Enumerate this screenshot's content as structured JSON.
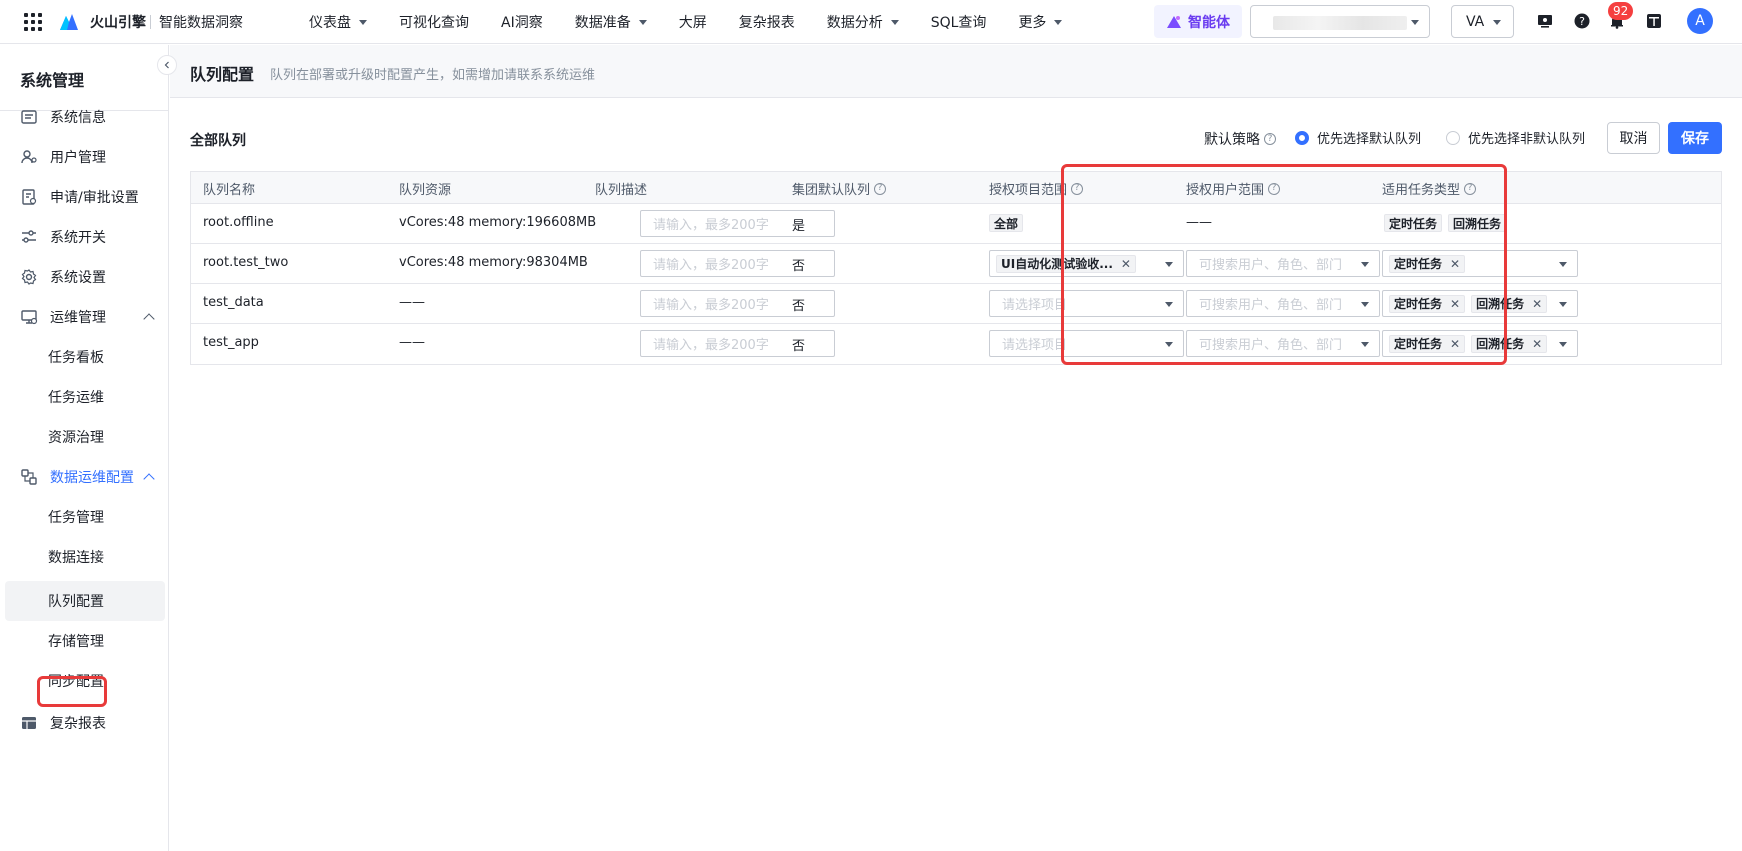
{
  "topnav": {
    "brand": "火山引擎",
    "product": "智能数据洞察",
    "menu": [
      {
        "label": "仪表盘",
        "dropdown": true
      },
      {
        "label": "可视化查询",
        "dropdown": false
      },
      {
        "label": "AI洞察",
        "dropdown": false
      },
      {
        "label": "数据准备",
        "dropdown": true
      },
      {
        "label": "大屏",
        "dropdown": false
      },
      {
        "label": "复杂报表",
        "dropdown": false
      },
      {
        "label": "数据分析",
        "dropdown": true
      },
      {
        "label": "SQL查询",
        "dropdown": false
      },
      {
        "label": "更多",
        "dropdown": true
      }
    ],
    "agent_label": "智能体",
    "workspace_value": "VA",
    "notification_count": "92",
    "avatar_letter": "A"
  },
  "sidebar": {
    "title": "系统管理",
    "items": [
      {
        "label": "系统信息",
        "icon": "info-panel-icon"
      },
      {
        "label": "用户管理",
        "icon": "users-icon"
      },
      {
        "label": "申请/审批设置",
        "icon": "approval-icon"
      },
      {
        "label": "系统开关",
        "icon": "toggle-icon"
      },
      {
        "label": "系统设置",
        "icon": "gear-icon"
      },
      {
        "label": "运维管理",
        "icon": "monitor-icon"
      },
      {
        "label": "任务看板"
      },
      {
        "label": "任务运维"
      },
      {
        "label": "资源治理"
      },
      {
        "label": "数据运维配置",
        "icon": "data-ops-icon"
      },
      {
        "label": "任务管理"
      },
      {
        "label": "数据连接"
      },
      {
        "label": "队列配置"
      },
      {
        "label": "存储管理"
      },
      {
        "label": "同步配置"
      },
      {
        "label": "复杂报表",
        "icon": "report-icon"
      }
    ]
  },
  "page": {
    "title": "队列配置",
    "hint": "队列在部署或升级时配置产生，如需增加请联系系统运维",
    "section_title": "全部队列",
    "strategy_label": "默认策略",
    "strategy_options": [
      "优先选择默认队列",
      "优先选择非默认队列"
    ],
    "strategy_selected": 0,
    "cancel_label": "取消",
    "save_label": "保存"
  },
  "table": {
    "headers": [
      "队列名称",
      "队列资源",
      "队列描述",
      "集团默认队列",
      "授权项目范围",
      "授权用户范围",
      "适用任务类型"
    ],
    "desc_placeholder": "请输入，最多200字",
    "project_placeholder": "请选择项目",
    "user_placeholder": "可搜索用户、角色、部门",
    "rows": [
      {
        "name": "root.offline",
        "resource": "vCores:48 memory:196608MB",
        "default": "是",
        "project_tag": "全部",
        "project_tag_removable": false,
        "user": "——",
        "task_tags": [
          "定时任务",
          "回溯任务"
        ],
        "task_tags_removable": false
      },
      {
        "name": "root.test_two",
        "resource": "vCores:48 memory:98304MB",
        "default": "否",
        "project_tag": "UI自动化测试验收...",
        "project_tag_removable": true,
        "user": "",
        "task_tags": [
          "定时任务"
        ],
        "task_tags_removable": true
      },
      {
        "name": "test_data",
        "resource": "——",
        "default": "否",
        "project_tag": "",
        "project_tag_removable": false,
        "user": "",
        "task_tags": [
          "定时任务",
          "回溯任务"
        ],
        "task_tags_removable": true
      },
      {
        "name": "test_app",
        "resource": "——",
        "default": "否",
        "project_tag": "",
        "project_tag_removable": false,
        "user": "",
        "task_tags": [
          "定时任务",
          "回溯任务"
        ],
        "task_tags_removable": true
      }
    ]
  }
}
